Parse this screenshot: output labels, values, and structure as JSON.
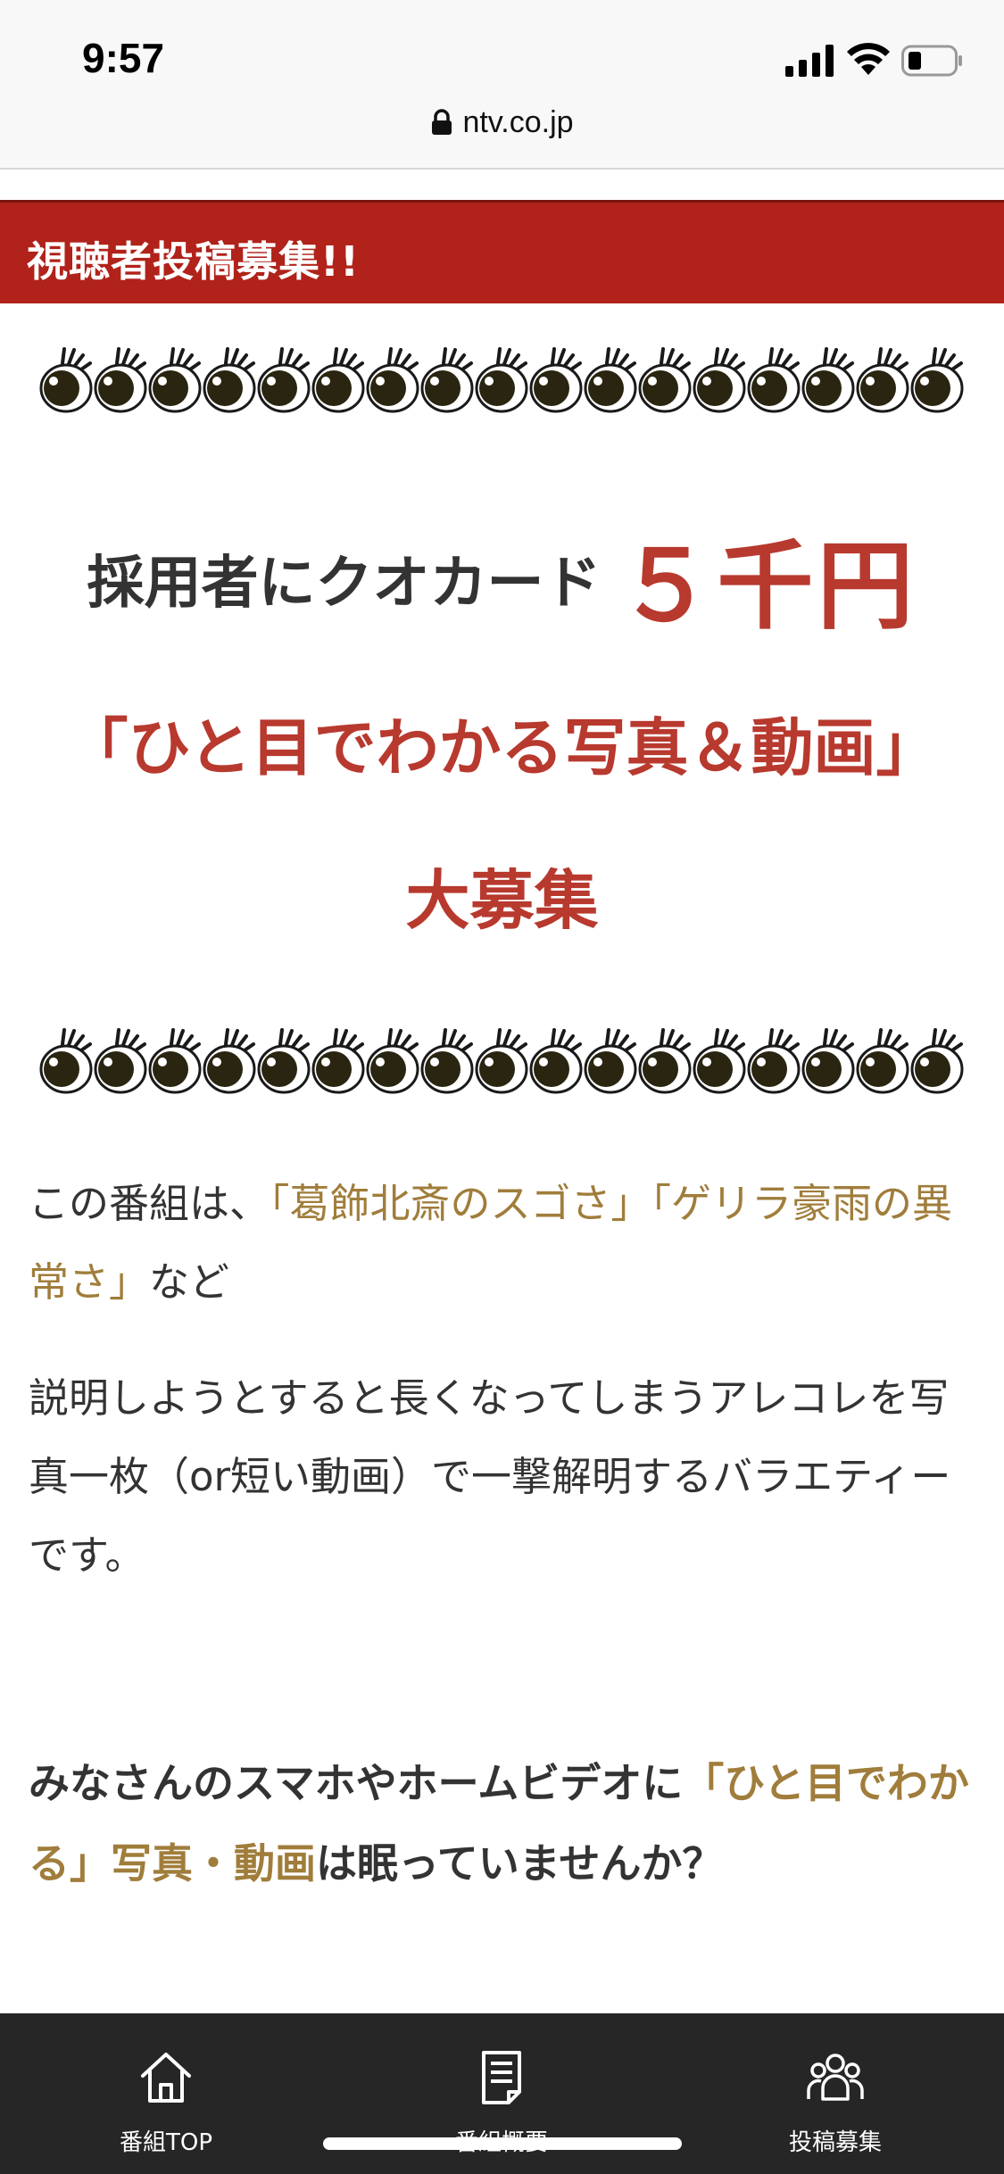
{
  "status_bar": {
    "time": "9:57",
    "url": "ntv.co.jp"
  },
  "banner": {
    "title": "視聴者投稿募集!!"
  },
  "eye_count": 17,
  "headline": {
    "prefix": "採用者にクオカード",
    "amount": "５千円"
  },
  "subheadline": "「ひと目でわかる写真＆動画」",
  "subheadline2": "大募集",
  "body": {
    "p1_a": "この番組は、",
    "p1_b": "「葛飾北斎のスゴさ」「ゲリラ豪雨の異常さ」",
    "p1_c": "など",
    "p2": "説明しようとすると長くなってしまうアレコレを写真一枚（or短い動画）で一撃解明するバラエティーです。",
    "p3_a": "みなさんのスマホやホームビデオに",
    "p3_b": "「ひと目でわかる」写真・動画",
    "p3_c": "は眠っていませんか？"
  },
  "tabs": [
    {
      "label": "番組TOP",
      "icon": "home-icon"
    },
    {
      "label": "番組概要",
      "icon": "document-icon"
    },
    {
      "label": "投稿募集",
      "icon": "people-icon"
    }
  ],
  "colors": {
    "banner": "#b0221a",
    "accent_red": "#b8392e",
    "accent_gold": "#a07d3b",
    "tabbar": "#262626"
  }
}
